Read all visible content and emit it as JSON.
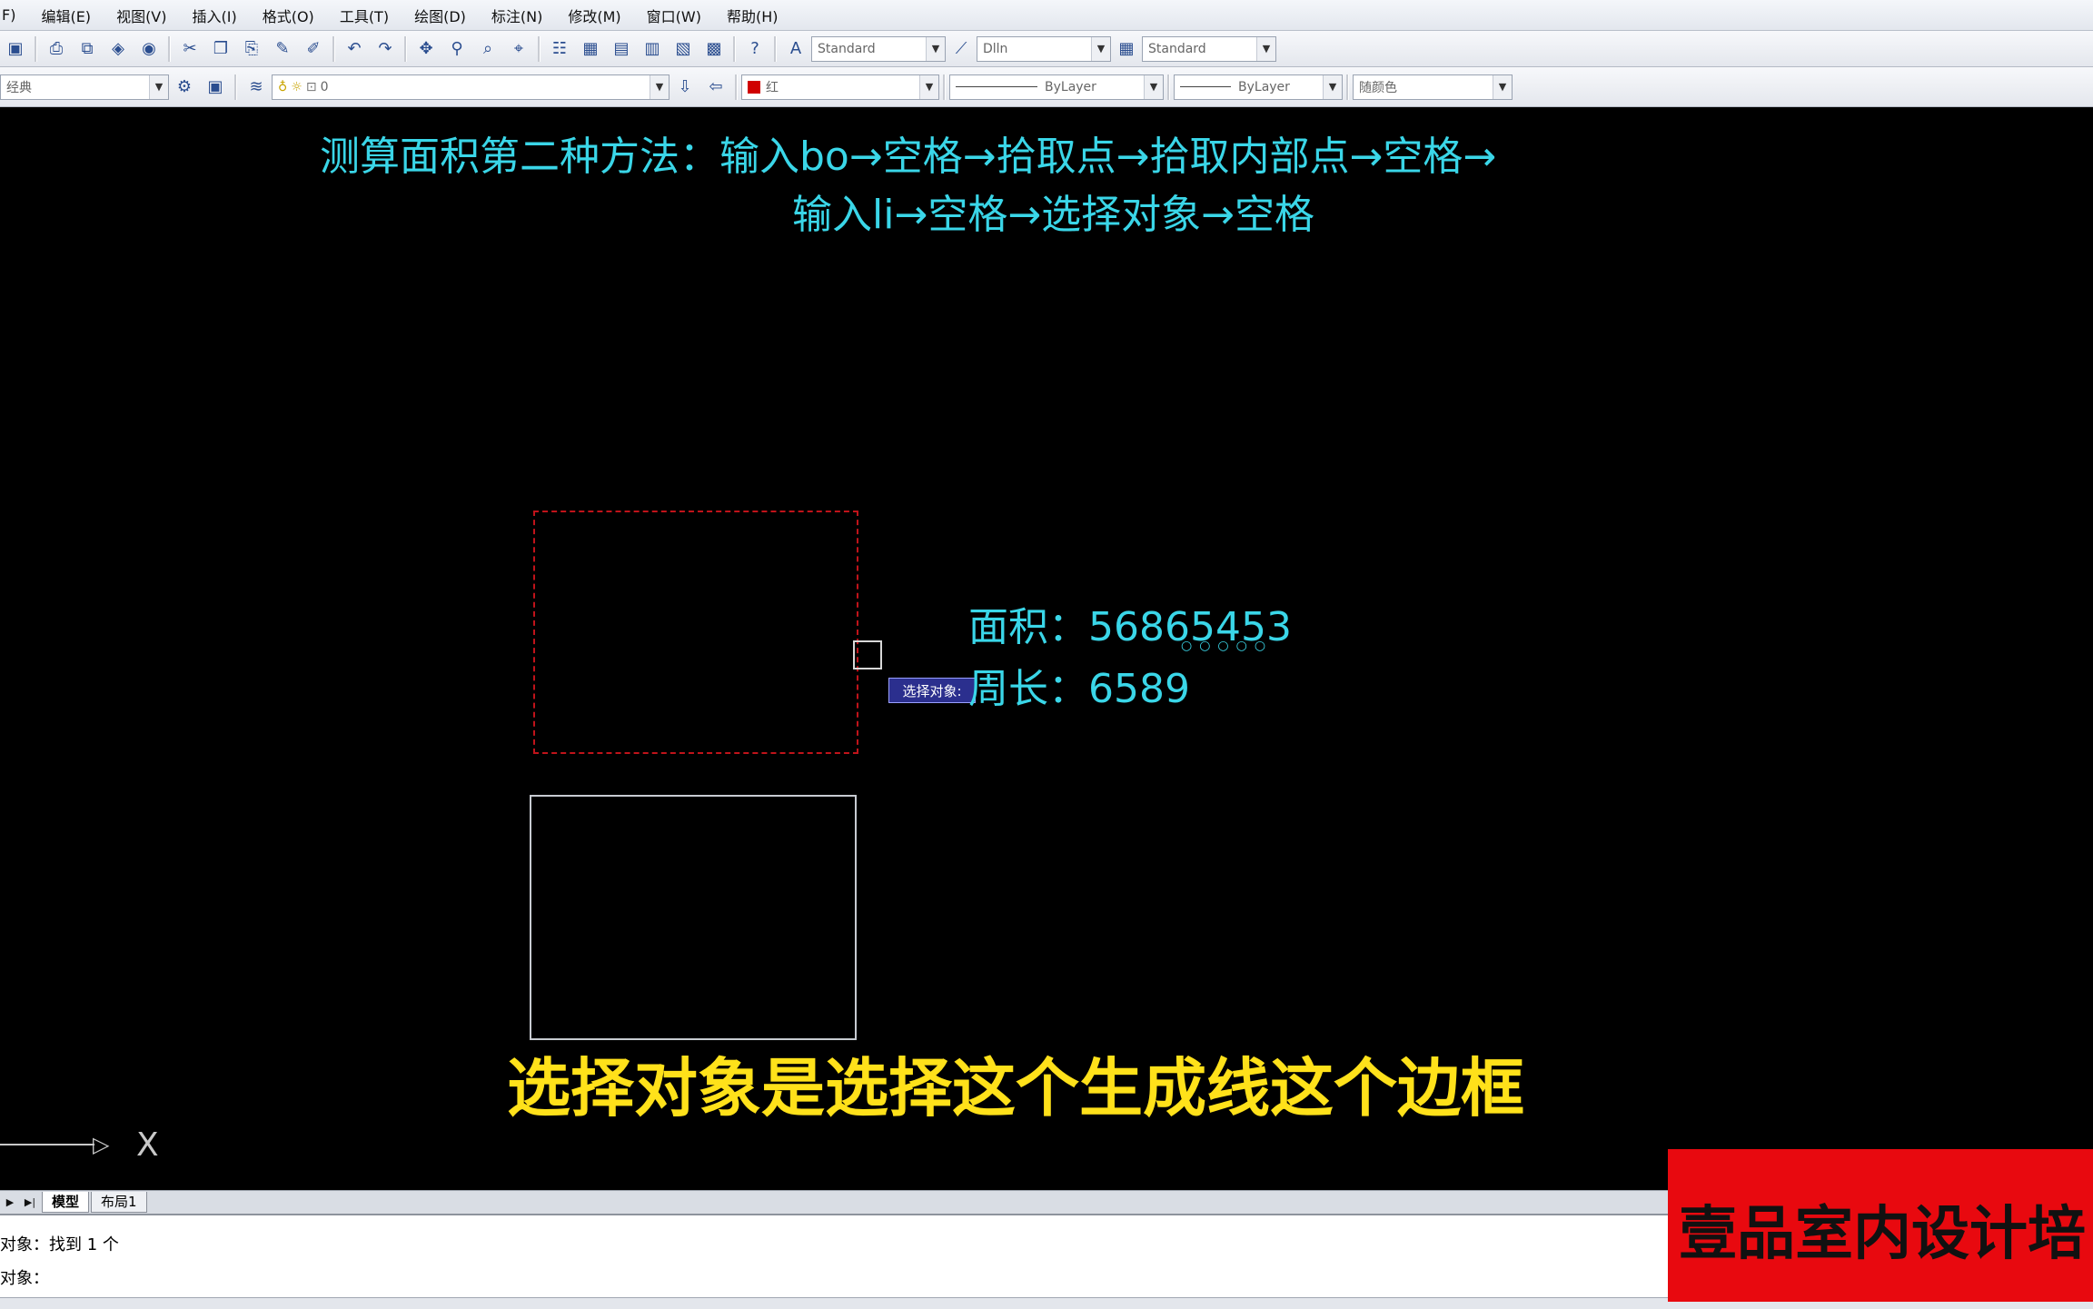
{
  "menu": [
    "F)",
    "编辑(E)",
    "视图(V)",
    "插入(I)",
    "格式(O)",
    "工具(T)",
    "绘图(D)",
    "标注(N)",
    "修改(M)",
    "窗口(W)",
    "帮助(H)"
  ],
  "toolbar1": {
    "text_style": "Standard",
    "dim_style": "Dlln",
    "table_style": "Standard"
  },
  "toolbar2": {
    "workspace": "经典",
    "layer": "0",
    "color": "红",
    "linetype": "ByLayer",
    "lineweight": "ByLayer",
    "plot_style": "随颜色"
  },
  "drawing": {
    "heading_line1": "测算面积第二种方法：输入bo→空格→拾取点→拾取内部点→空格→",
    "heading_line2": "输入li→空格→选择对象→空格",
    "area_text": "面积：56865453",
    "perimeter_text": "周长：6589",
    "tooltip": "选择对象:",
    "subtitle": "选择对象是选择这个生成线这个边框",
    "ucs_x": "X"
  },
  "tabs": [
    "模型",
    "布局1"
  ],
  "command": {
    "line1": "对象：找到 1 个",
    "line2": "对象："
  },
  "logo": {
    "text": "壹品室内设计培"
  },
  "colors": {
    "annotation": "#3ad6e8",
    "subtitle": "#ffe11a",
    "dashed_rect": "#c0131a",
    "logo_bg": "#e8090f"
  }
}
